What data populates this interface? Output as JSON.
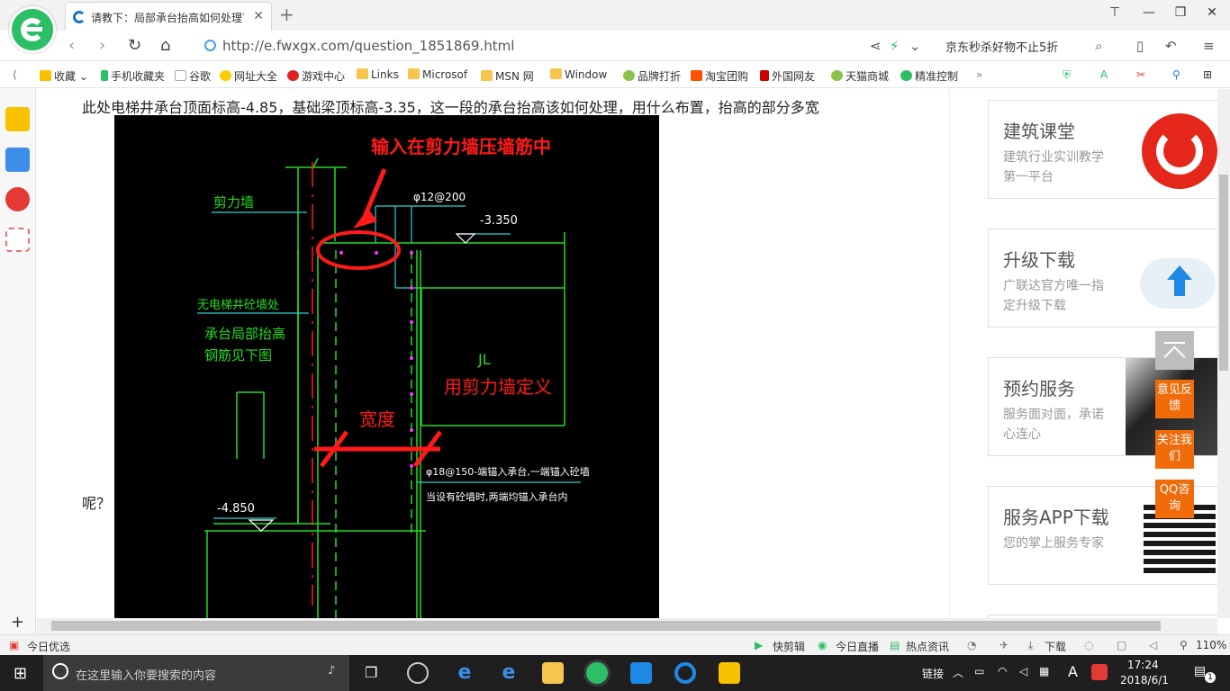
{
  "browser": {
    "tab_title": "请教下：局部承台抬高如何处理？",
    "new_tab": "+",
    "url": "http://e.fwxgx.com/question_1851869.html",
    "search_box": "京东秒杀好物不止5折"
  },
  "bookmarks": [
    "收藏",
    "手机收藏夹",
    "谷歌",
    "网址大全",
    "游戏中心",
    "Links",
    "Microsof",
    "MSN 网",
    "Window",
    "品牌打折",
    "淘宝团购",
    "外国网友",
    "天猫商城",
    "精准控制"
  ],
  "content": {
    "question": "此处电梯井承台顶面标高-4.85，基础梁顶标高-3.35，这一段的承台抬高该如何处理，用什么布置，抬高的部分多宽",
    "question_tail": "呢？"
  },
  "cad": {
    "annotation_top": "输入在剪力墙压墙筋中",
    "annotation_jl": "JL",
    "annotation_define": "用剪力墙定义",
    "annotation_width": "宽度",
    "label_shear_wall": "剪力墙",
    "label_rebar_top": "φ12@200",
    "label_level_top": "-3.350",
    "label_no_elevator_wall": "无电梯井砼墙处",
    "label_local_raise_1": "承台局部抬高",
    "label_local_raise_2": "钢筋见下图",
    "label_rebar_bottom": "φ18@150-端锚入承台,一端锚入砼墙",
    "label_rebar_note": "当设有砼墙时,两端均锚入承台内",
    "label_level_bottom": "-4.850"
  },
  "ads": [
    {
      "title": "建筑课堂",
      "desc": "建筑行业实训教学第一平台"
    },
    {
      "title": "升级下载",
      "desc": "广联达官方唯一指定升级下载"
    },
    {
      "title": "预约服务",
      "desc": "服务面对面，承诺心连心"
    },
    {
      "title": "服务APP下载",
      "desc": "您的掌上服务专家"
    }
  ],
  "side_buttons": [
    "意见反馈",
    "关注我们",
    "QQ咨询"
  ],
  "statusbar": {
    "left": "今日优选",
    "items": [
      "快剪辑",
      "今日直播",
      "热点资讯",
      "下载"
    ],
    "zoom": "110%"
  },
  "taskbar": {
    "search_placeholder": "在这里输入你要搜索的内容",
    "link_label": "链接",
    "ime": "A",
    "time": "17:24",
    "date": "2018/6/1",
    "notifications": "1"
  },
  "colors": {
    "cad_green": "#22dd22",
    "cad_red": "#ff1a1a",
    "cad_cyan": "#2ad3d3",
    "cad_magenta": "#ff33ff",
    "accent_orange": "#f06b0a"
  }
}
